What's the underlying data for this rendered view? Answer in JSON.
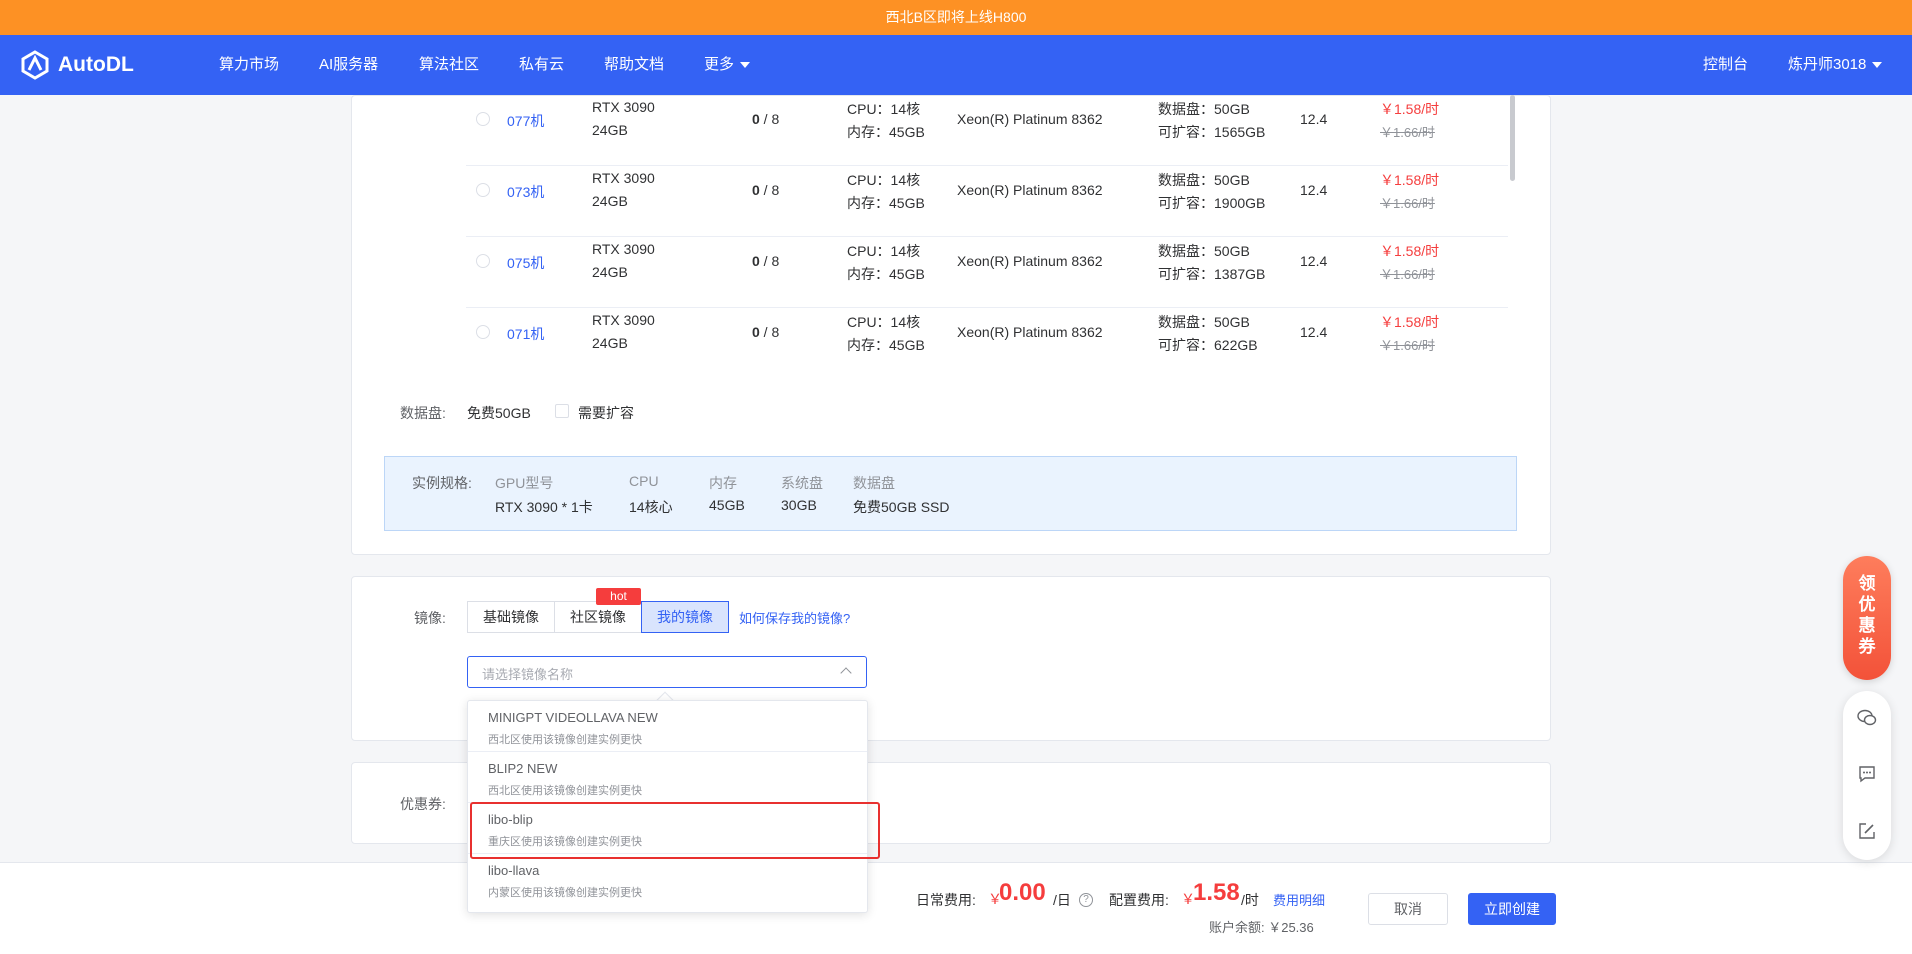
{
  "banner": {
    "text": "西北B区即将上线H800"
  },
  "nav": {
    "logo": "AutoDL",
    "items": [
      "算力市场",
      "AI服务器",
      "算法社区",
      "私有云",
      "帮助文档",
      "更多"
    ],
    "console": "控制台",
    "user": "炼丹师3018"
  },
  "machines": [
    {
      "name": "077机",
      "gpu": "RTX 3090",
      "vram": "24GB",
      "avail": "0",
      "total": " / 8",
      "cpu": "CPU：14核",
      "mem": "内存：45GB",
      "cpu_model": "Xeon(R) Platinum 8362",
      "disk": "数据盘：50GB",
      "expand": "可扩容：1565GB",
      "cuda": "12.4",
      "price": "￥1.58/时",
      "orig_price": "￥1.66/时"
    },
    {
      "name": "073机",
      "gpu": "RTX 3090",
      "vram": "24GB",
      "avail": "0",
      "total": " / 8",
      "cpu": "CPU：14核",
      "mem": "内存：45GB",
      "cpu_model": "Xeon(R) Platinum 8362",
      "disk": "数据盘：50GB",
      "expand": "可扩容：1900GB",
      "cuda": "12.4",
      "price": "￥1.58/时",
      "orig_price": "￥1.66/时"
    },
    {
      "name": "075机",
      "gpu": "RTX 3090",
      "vram": "24GB",
      "avail": "0",
      "total": " / 8",
      "cpu": "CPU：14核",
      "mem": "内存：45GB",
      "cpu_model": "Xeon(R) Platinum 8362",
      "disk": "数据盘：50GB",
      "expand": "可扩容：1387GB",
      "cuda": "12.4",
      "price": "￥1.58/时",
      "orig_price": "￥1.66/时"
    },
    {
      "name": "071机",
      "gpu": "RTX 3090",
      "vram": "24GB",
      "avail": "0",
      "total": " / 8",
      "cpu": "CPU：14核",
      "mem": "内存：45GB",
      "cpu_model": "Xeon(R) Platinum 8362",
      "disk": "数据盘：50GB",
      "expand": "可扩容：622GB",
      "cuda": "12.4",
      "price": "￥1.58/时",
      "orig_price": "￥1.66/时"
    }
  ],
  "data_disk": {
    "label": "数据盘:",
    "free": "免费50GB",
    "expand_label": "需要扩容"
  },
  "spec": {
    "label": "实例规格:",
    "headers": [
      "GPU型号",
      "CPU",
      "内存",
      "系统盘",
      "数据盘"
    ],
    "values": [
      "RTX 3090 * 1卡",
      "14核心",
      "45GB",
      "30GB",
      "免费50GB SSD"
    ]
  },
  "image": {
    "label": "镜像:",
    "tabs": [
      "基础镜像",
      "社区镜像",
      "我的镜像"
    ],
    "hot": "hot",
    "help_link": "如何保存我的镜像?",
    "placeholder": "请选择镜像名称",
    "options": [
      {
        "name": "MINIGPT VIDEOLLAVA NEW",
        "desc": "西北区使用该镜像创建实例更快"
      },
      {
        "name": "BLIP2 NEW",
        "desc": "西北区使用该镜像创建实例更快"
      },
      {
        "name": "libo-blip",
        "desc": "重庆区使用该镜像创建实例更快"
      },
      {
        "name": "libo-llava",
        "desc": "内蒙区使用该镜像创建实例更快"
      }
    ]
  },
  "coupon": {
    "label": "优惠券:"
  },
  "footer": {
    "daily_label": "日常费用:",
    "daily_cur": "￥",
    "daily_value": "0.00",
    "daily_unit": "/日",
    "config_label": "配置费用:",
    "config_cur": "￥",
    "config_value": "1.58",
    "config_unit": "/时",
    "detail_link": "费用明细",
    "balance": "账户余额: ￥25.36",
    "cancel": "取消",
    "create": "立即创建"
  },
  "side": {
    "promo": [
      "领",
      "优",
      "惠",
      "券"
    ]
  }
}
